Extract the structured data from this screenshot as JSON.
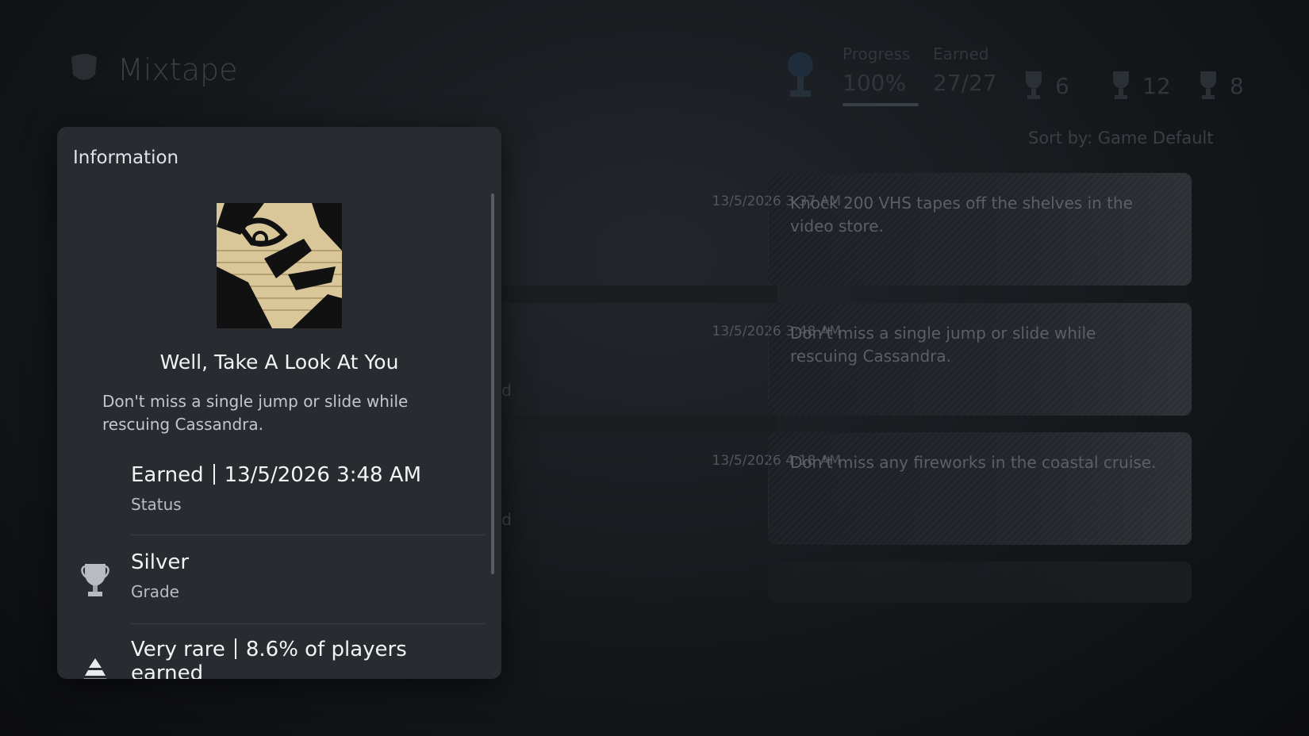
{
  "header": {
    "game_title": "Mixtape",
    "progress_label": "Progress",
    "progress_value": "100%",
    "earned_label": "Earned",
    "earned_value": "27/27",
    "gold_count": "6",
    "silver_count": "12",
    "bronze_count": "8",
    "sort_label": "Sort by: Game Default"
  },
  "list": {
    "rows": [
      {
        "date": "13/5/2026  3:37 AM",
        "description": "Knock 200 VHS tapes off the shelves in the video store.",
        "stub": ""
      },
      {
        "date": "13/5/2026  3:48 AM",
        "description": "Don't miss a single jump or slide while rescuing Cassandra.",
        "stub": "ed"
      },
      {
        "date": "13/5/2026  4:18 AM",
        "description": "Don't miss any fireworks in the coastal cruise.",
        "stub": "ed"
      }
    ]
  },
  "panel": {
    "title": "Information",
    "trophy_name": "Well, Take A Look At You",
    "trophy_description": "Don't miss a single jump or slide while rescuing Cassandra.",
    "status_main_prefix": "Earned",
    "status_main_value": "13/5/2026  3:48 AM",
    "status_label": "Status",
    "grade_value": "Silver",
    "grade_label": "Grade",
    "rarity_prefix": "Very rare",
    "rarity_value": "8.6% of players earned",
    "icons": {
      "grade": "silver-trophy-icon",
      "rarity": "rarity-pyramid-icon",
      "art": "trophy-artwork"
    }
  }
}
